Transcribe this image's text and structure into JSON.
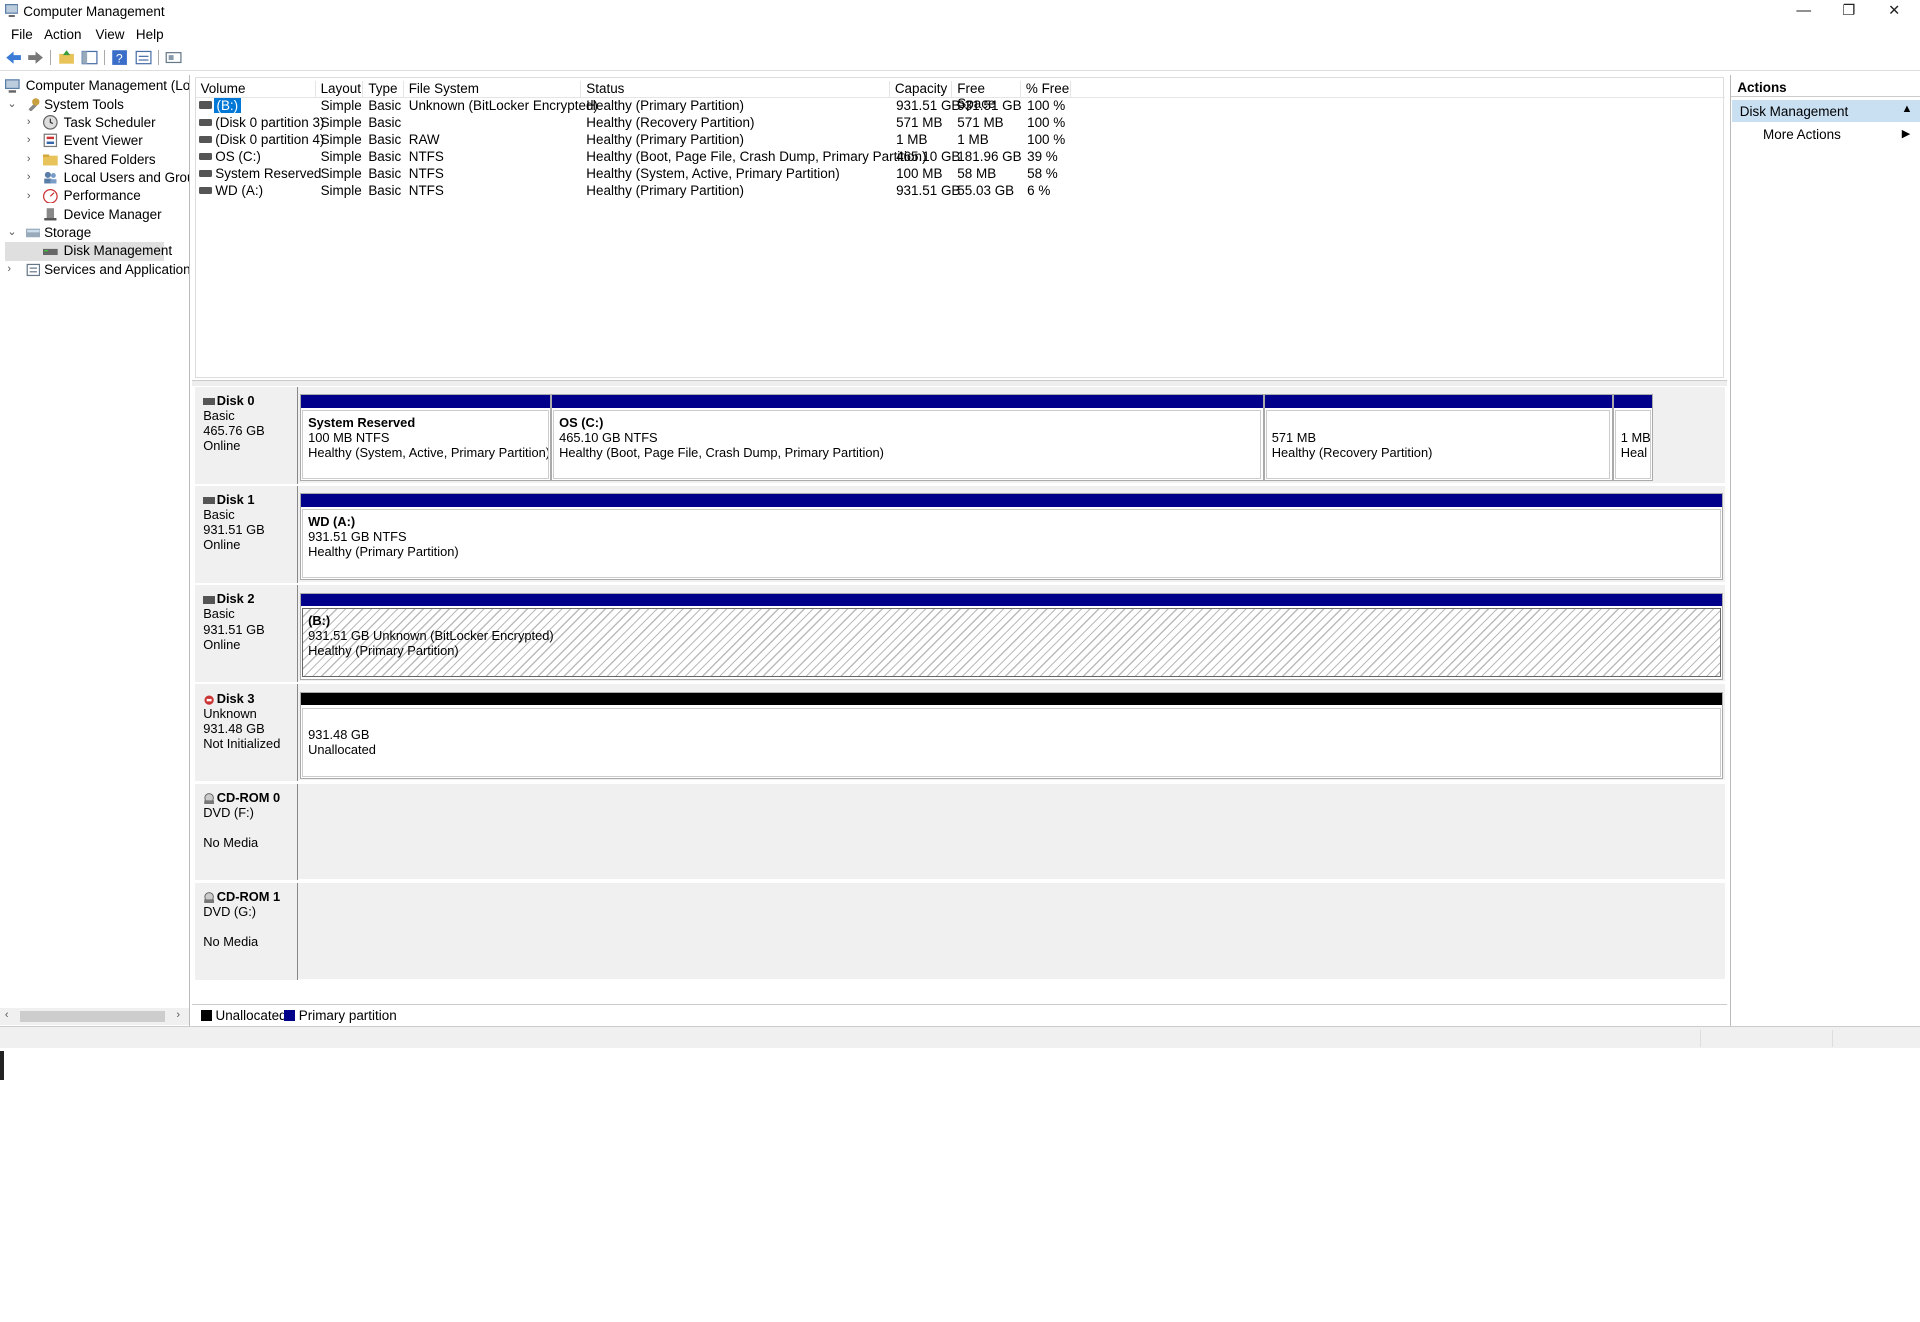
{
  "window": {
    "title": "Computer Management",
    "minimize": "—",
    "restore": "❐",
    "close": "✕"
  },
  "menu": [
    "File",
    "Action",
    "View",
    "Help"
  ],
  "tree": {
    "root": "Computer Management (Local",
    "system_tools": "System Tools",
    "task_scheduler": "Task Scheduler",
    "event_viewer": "Event Viewer",
    "shared_folders": "Shared Folders",
    "local_users": "Local Users and Groups",
    "performance": "Performance",
    "device_manager": "Device Manager",
    "storage": "Storage",
    "disk_management": "Disk Management",
    "services": "Services and Applications"
  },
  "volume_table": {
    "headers": [
      "Volume",
      "Layout",
      "Type",
      "File System",
      "Status",
      "Capacity",
      "Free Space",
      "% Free"
    ],
    "rows": [
      [
        "(B:)",
        "Simple",
        "Basic",
        "Unknown (BitLocker Encrypted)",
        "Healthy (Primary Partition)",
        "931.51 GB",
        "931.51 GB",
        "100 %"
      ],
      [
        "(Disk 0 partition 3)",
        "Simple",
        "Basic",
        "",
        "Healthy (Recovery Partition)",
        "571 MB",
        "571 MB",
        "100 %"
      ],
      [
        "(Disk 0 partition 4)",
        "Simple",
        "Basic",
        "RAW",
        "Healthy (Primary Partition)",
        "1 MB",
        "1 MB",
        "100 %"
      ],
      [
        "OS (C:)",
        "Simple",
        "Basic",
        "NTFS",
        "Healthy (Boot, Page File, Crash Dump, Primary Partition)",
        "465.10 GB",
        "181.96 GB",
        "39 %"
      ],
      [
        "System Reserved",
        "Simple",
        "Basic",
        "NTFS",
        "Healthy (System, Active, Primary Partition)",
        "100 MB",
        "58 MB",
        "58 %"
      ],
      [
        "WD (A:)",
        "Simple",
        "Basic",
        "NTFS",
        "Healthy (Primary Partition)",
        "931.51 GB",
        "55.03 GB",
        "6 %"
      ]
    ]
  },
  "disks": {
    "d0": {
      "name": "Disk 0",
      "type": "Basic",
      "size": "465.76 GB",
      "state": "Online",
      "p1": {
        "name": "System Reserved",
        "l2": "100 MB NTFS",
        "l3": "Healthy (System, Active, Primary Partition)"
      },
      "p2": {
        "name": "OS  (C:)",
        "l2": "465.10 GB NTFS",
        "l3": "Healthy (Boot, Page File, Crash Dump, Primary Partition)"
      },
      "p3": {
        "l2": "571 MB",
        "l3": "Healthy (Recovery Partition)"
      },
      "p4": {
        "l2": "1 MB",
        "l3": "Heal"
      }
    },
    "d1": {
      "name": "Disk 1",
      "type": "Basic",
      "size": "931.51 GB",
      "state": "Online",
      "p1": {
        "name": "WD  (A:)",
        "l2": "931.51 GB NTFS",
        "l3": "Healthy (Primary Partition)"
      }
    },
    "d2": {
      "name": "Disk 2",
      "type": "Basic",
      "size": "931.51 GB",
      "state": "Online",
      "p1": {
        "name": "(B:)",
        "l2": "931.51 GB Unknown (BitLocker Encrypted)",
        "l3": "Healthy (Primary Partition)"
      }
    },
    "d3": {
      "name": "Disk 3",
      "type": "Unknown",
      "size": "931.48 GB",
      "state": "Not Initialized",
      "p1": {
        "l2": "931.48 GB",
        "l3": "Unallocated"
      }
    },
    "cd0": {
      "name": "CD-ROM 0",
      "type": "DVD (F:)",
      "state": "No Media"
    },
    "cd1": {
      "name": "CD-ROM 1",
      "type": "DVD (G:)",
      "state": "No Media"
    }
  },
  "legend": {
    "unallocated": "Unallocated",
    "primary": "Primary partition"
  },
  "actions": {
    "header": "Actions",
    "section": "Disk Management",
    "more": "More Actions"
  },
  "colors": {
    "primary_partition": "#00008b",
    "unallocated": "#000000",
    "selection": "#0078d7",
    "actions_section": "#c9dff2"
  }
}
